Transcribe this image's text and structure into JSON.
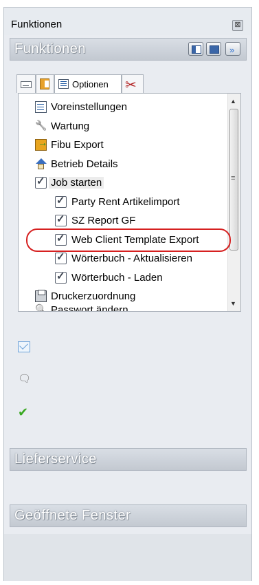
{
  "window": {
    "title": "Funktionen",
    "close_glyph": "⊠"
  },
  "functions_header": {
    "label": "Funktionen"
  },
  "tabs": [
    {
      "icon": "keyboard-icon",
      "label": ""
    },
    {
      "icon": "book-icon",
      "label": ""
    },
    {
      "icon": "list-icon",
      "label": "Optionen"
    },
    {
      "icon": "tools-icon",
      "label": ""
    }
  ],
  "tree": {
    "items": [
      {
        "icon": "list-icon",
        "label": "Voreinstellungen",
        "level": 0
      },
      {
        "icon": "wrench-icon",
        "label": "Wartung",
        "level": 0
      },
      {
        "icon": "fibu-export-icon",
        "label": "Fibu Export",
        "level": 0
      },
      {
        "icon": "house-icon",
        "label": "Betrieb Details",
        "level": 0
      },
      {
        "icon": "checkbox-icon",
        "label": "Job starten",
        "level": 0
      },
      {
        "icon": "checkbox-icon",
        "label": "Party Rent Artikelimport",
        "level": 1
      },
      {
        "icon": "checkbox-icon",
        "label": "SZ Report GF",
        "level": 1
      },
      {
        "icon": "checkbox-icon",
        "label": "Web Client Template Export",
        "level": 1
      },
      {
        "icon": "checkbox-icon",
        "label": "Wörterbuch - Aktualisieren",
        "level": 1
      },
      {
        "icon": "checkbox-icon",
        "label": "Wörterbuch - Laden",
        "level": 1
      },
      {
        "icon": "printer-icon",
        "label": "Druckerzuordnung",
        "level": 0
      },
      {
        "icon": "key-icon",
        "label": "Passwort ändern",
        "level": 0
      }
    ]
  },
  "side_icons": [
    "mail-icon",
    "chat-icon",
    "checkmark-icon"
  ],
  "lieferservice_header": {
    "label": "Lieferservice"
  },
  "open_windows_header": {
    "label": "Geöffnete Fenster"
  },
  "colors": {
    "highlight": "#d62020",
    "panel_bg": "#e9ecf1"
  }
}
